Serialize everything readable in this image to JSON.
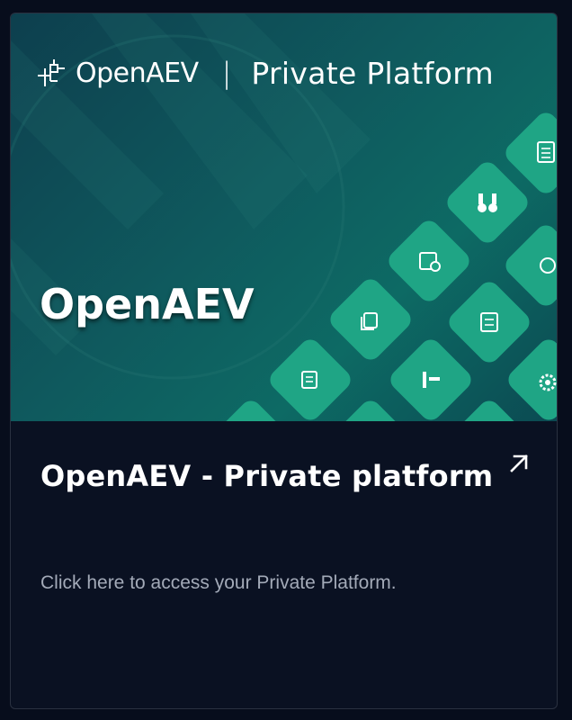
{
  "card": {
    "banner": {
      "brand_name": "OpenAEV",
      "separator": "|",
      "subtitle": "Private Platform",
      "hero_title": "OpenAEV"
    },
    "title": "OpenAEV - Private platform",
    "description": "Click here to access your Private Platform.",
    "external_link_icon": "arrow-up-right-icon"
  },
  "colors": {
    "page_background": "#070d1c",
    "card_background": "#0a1122",
    "banner_teal": "#0f5a5e",
    "tile_green": "#1fa585",
    "text_primary": "#ffffff",
    "text_secondary": "#a3aab8"
  }
}
